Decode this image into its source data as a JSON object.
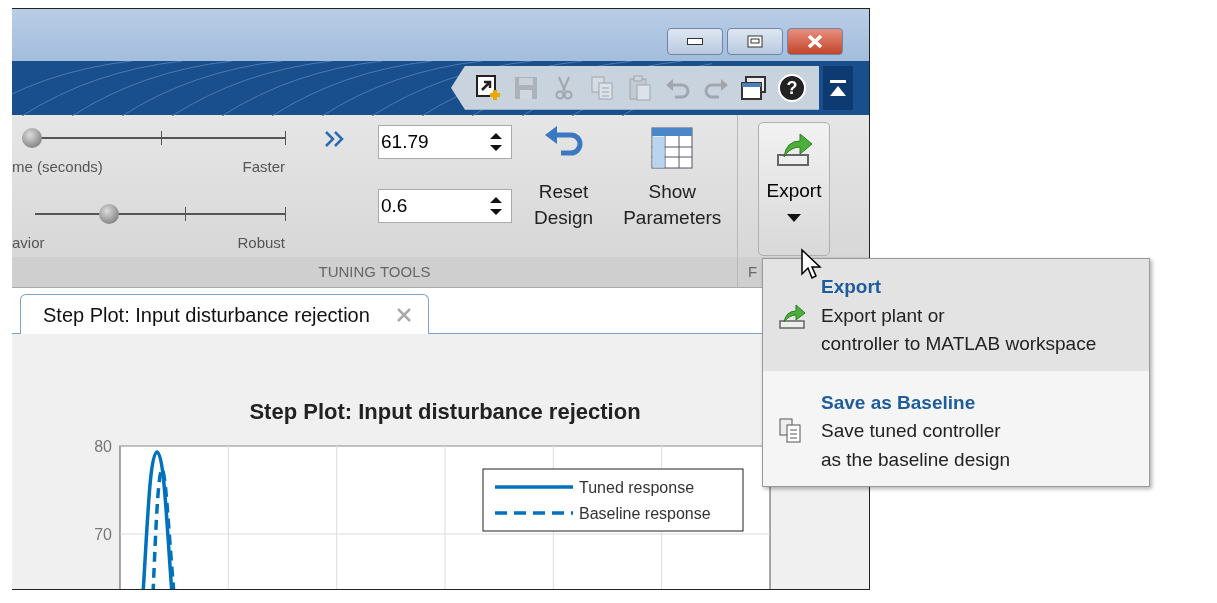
{
  "window": {
    "controls": [
      {
        "kind": "minimize"
      },
      {
        "kind": "maximize"
      },
      {
        "kind": "close"
      }
    ]
  },
  "quick_access": {
    "items": [
      {
        "kind": "new-shortcut",
        "disabled": false
      },
      {
        "kind": "save",
        "disabled": true
      },
      {
        "kind": "cut",
        "disabled": true
      },
      {
        "kind": "copy",
        "disabled": true
      },
      {
        "kind": "paste",
        "disabled": true
      },
      {
        "kind": "undo",
        "disabled": true
      },
      {
        "kind": "redo",
        "disabled": true
      },
      {
        "kind": "windows",
        "disabled": false
      },
      {
        "kind": "help",
        "disabled": false,
        "glyph": "?"
      }
    ],
    "collapse": {
      "expanded": true
    }
  },
  "tuning_tools": {
    "sliders": [
      {
        "left_label": "me (seconds)",
        "right_label": "Faster",
        "level": 0.0
      },
      {
        "left_label": "avior",
        "right_label": "Robust",
        "level": 0.28
      }
    ],
    "fields": [
      {
        "value": "61.79"
      },
      {
        "value": "0.6"
      }
    ],
    "buttons": [
      {
        "kind": "reset",
        "lines": [
          "Reset",
          "Design"
        ]
      },
      {
        "kind": "parameters",
        "lines": [
          "Show",
          "Parameters"
        ]
      }
    ],
    "section_label": "TUNING TOOLS"
  },
  "export_section": {
    "button": {
      "label": "Export",
      "expanded": true
    },
    "section_label": "F"
  },
  "document_tabs": [
    {
      "label": "Step Plot: Input disturbance rejection",
      "selected": true
    }
  ],
  "plot": {
    "title": "Step Plot: Input disturbance rejection",
    "y_tick_labels": [
      "80",
      "70"
    ],
    "legend": [
      {
        "label": "Tuned response",
        "kind": "solid"
      },
      {
        "label": "Baseline response",
        "kind": "dashed"
      }
    ]
  },
  "menu": {
    "items": [
      {
        "kind": "export",
        "title": "Export",
        "lines": [
          "Export plant or",
          "controller to MATLAB workspace"
        ],
        "selected": true
      },
      {
        "kind": "baseline",
        "title": "Save as Baseline",
        "lines": [
          "Save tuned controller",
          "as the baseline design"
        ],
        "selected": false
      }
    ]
  }
}
